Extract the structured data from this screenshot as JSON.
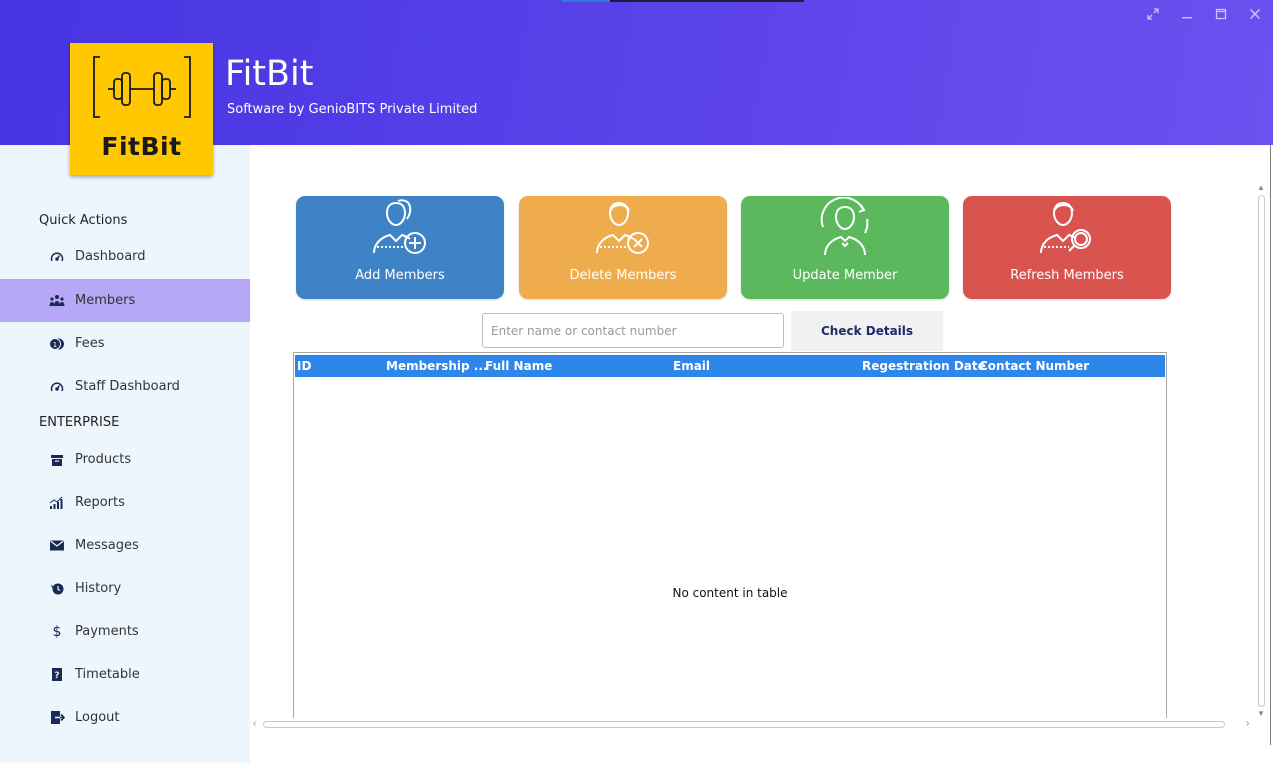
{
  "app": {
    "title": "FitBit",
    "subtitle": "Software by GenioBITS Private Limited",
    "logo_text": "FitBit"
  },
  "window_controls": [
    "expand-icon",
    "minimize-icon",
    "maximize-icon",
    "close-icon"
  ],
  "sidebar": {
    "sections": [
      {
        "label": "Quick Actions",
        "items": [
          {
            "label": "Dashboard",
            "icon": "speedometer-icon",
            "active": false
          },
          {
            "label": "Members",
            "icon": "members-icon",
            "active": true
          },
          {
            "label": "Fees",
            "icon": "coins-icon",
            "active": false
          },
          {
            "label": "Staff Dashboard",
            "icon": "speedometer-icon",
            "active": false
          }
        ]
      },
      {
        "label": "ENTERPRISE",
        "items": [
          {
            "label": "Products",
            "icon": "box-icon",
            "active": false
          },
          {
            "label": "Reports",
            "icon": "bar-chart-icon",
            "active": false
          },
          {
            "label": "Messages",
            "icon": "envelope-icon",
            "active": false
          },
          {
            "label": "History",
            "icon": "history-icon",
            "active": false
          },
          {
            "label": "Payments",
            "icon": "dollar-icon",
            "active": false
          },
          {
            "label": "Timetable",
            "icon": "question-book-icon",
            "active": false
          },
          {
            "label": "Logout",
            "icon": "logout-icon",
            "active": false
          }
        ]
      }
    ]
  },
  "actions": [
    {
      "label": "Add Members",
      "icon": "user-add-icon",
      "color": "#3d83c6"
    },
    {
      "label": "Delete Members",
      "icon": "user-delete-icon",
      "color": "#eeac4d"
    },
    {
      "label": "Update Member",
      "icon": "user-update-icon",
      "color": "#5cb85c"
    },
    {
      "label": "Refresh Members",
      "icon": "user-search-icon",
      "color": "#d9534f"
    }
  ],
  "search": {
    "placeholder": "Enter name or contact number",
    "value": "",
    "button_label": "Check Details"
  },
  "table": {
    "columns": [
      "ID",
      "Membership ...",
      "Full Name",
      "Email",
      "Regestration Date",
      "Contact Number"
    ],
    "rows": [],
    "empty_text": "No content in table"
  },
  "colors": {
    "header_gradient_start": "#4535e2",
    "header_gradient_end": "#6a52ef",
    "sidebar_bg": "#eef6fd",
    "active_item": "#b7a8f7",
    "logo_bg": "#ffc800",
    "table_header": "#2f86ea"
  }
}
